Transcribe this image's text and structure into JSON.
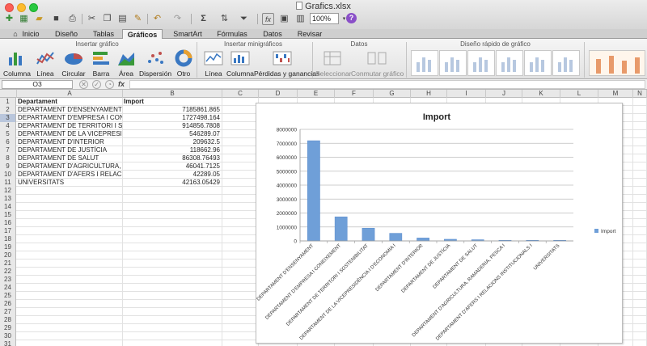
{
  "window": {
    "title": "Grafics.xlsx",
    "zoom": "100%"
  },
  "tabs": [
    "Inicio",
    "Diseño",
    "Tablas",
    "Gráficos",
    "SmartArt",
    "Fórmulas",
    "Datos",
    "Revisar"
  ],
  "active_tab": "Gráficos",
  "ribbon": {
    "groups": {
      "insert_chart": "Insertar gráfico",
      "sparklines": "Insertar minigráficos",
      "data": "Datos",
      "quick_layout": "Diseño rápido de gráfico"
    },
    "chart_buttons": [
      "Columna",
      "Línea",
      "Circular",
      "Barra",
      "Área",
      "Dispersión",
      "Otro"
    ],
    "spark_buttons": [
      "Línea",
      "Columna",
      "Pérdidas y ganancias"
    ],
    "data_buttons": [
      "Seleccionar",
      "Conmutar gráfico"
    ]
  },
  "formula_bar": {
    "name_box": "O3",
    "formula": ""
  },
  "columns": [
    "A",
    "B",
    "C",
    "D",
    "E",
    "F",
    "G",
    "H",
    "I",
    "J",
    "K",
    "L",
    "M",
    "N"
  ],
  "sheet": {
    "header": {
      "a": "Departament",
      "b": "Import"
    },
    "rows": [
      {
        "a": "DEPARTAMENT D'ENSENYAMENT",
        "b": "7185861.865"
      },
      {
        "a": "DEPARTAMENT D'EMPRESA I CONEIXEMENT",
        "b": "1727498.164"
      },
      {
        "a": "DEPARTAMENT DE TERRITORI I SOSTENIBILITAT",
        "b": "914856.7808"
      },
      {
        "a": "DEPARTAMENT DE LA VICEPRESIDÈNCIA I D'ECONOMIA I",
        "b": "546289.07"
      },
      {
        "a": "DEPARTAMENT D'INTERIOR",
        "b": "209632.5"
      },
      {
        "a": "DEPARTAMENT DE JUSTÍCIA",
        "b": "118662.96"
      },
      {
        "a": "DEPARTAMENT DE SALUT",
        "b": "86308.76493"
      },
      {
        "a": "DEPARTAMENT D'AGRICULTURA, RAMADERIA, PESCA I",
        "b": "46041.7125"
      },
      {
        "a": "DEPARTAMENT D'AFERS I RELACIONS INSTITUCIONALS I",
        "b": "42289.05"
      },
      {
        "a": "UNIVERSITATS",
        "b": "42163.05429"
      }
    ],
    "row_count": 31
  },
  "chart_data": {
    "type": "bar",
    "title": "Import",
    "categories": [
      "DEPARTAMENT D'ENSENYAMENT",
      "DEPARTAMENT D'EMPRESA I CONEIXEMENT",
      "DEPARTAMENT DE TERRITORI I SOSTENIBILITAT",
      "DEPARTAMENT DE LA VICEPRESIDÈNCIA I D'ECONOMIA I",
      "DEPARTAMENT D'INTERIOR",
      "DEPARTAMENT DE JUSTÍCIA",
      "DEPARTAMENT DE SALUT",
      "DEPARTAMENT D'AGRICULTURA, RAMADERIA, PESCA I",
      "DEPARTAMENT D'AFERS I RELACIONS INSTITUCIONALS I",
      "UNIVERSITATS"
    ],
    "series": [
      {
        "name": "Import",
        "values": [
          7185861.865,
          1727498.164,
          914856.7808,
          546289.07,
          209632.5,
          118662.96,
          86308.76493,
          46041.7125,
          42289.05,
          42163.05429
        ]
      }
    ],
    "ylim": [
      0,
      8000000
    ],
    "yticks": [
      "0",
      "1000000",
      "2000000",
      "3000000",
      "4000000",
      "5000000",
      "6000000",
      "7000000",
      "8000000"
    ],
    "grid": true,
    "legend": "right",
    "bar_color": "#6f9fd8"
  }
}
